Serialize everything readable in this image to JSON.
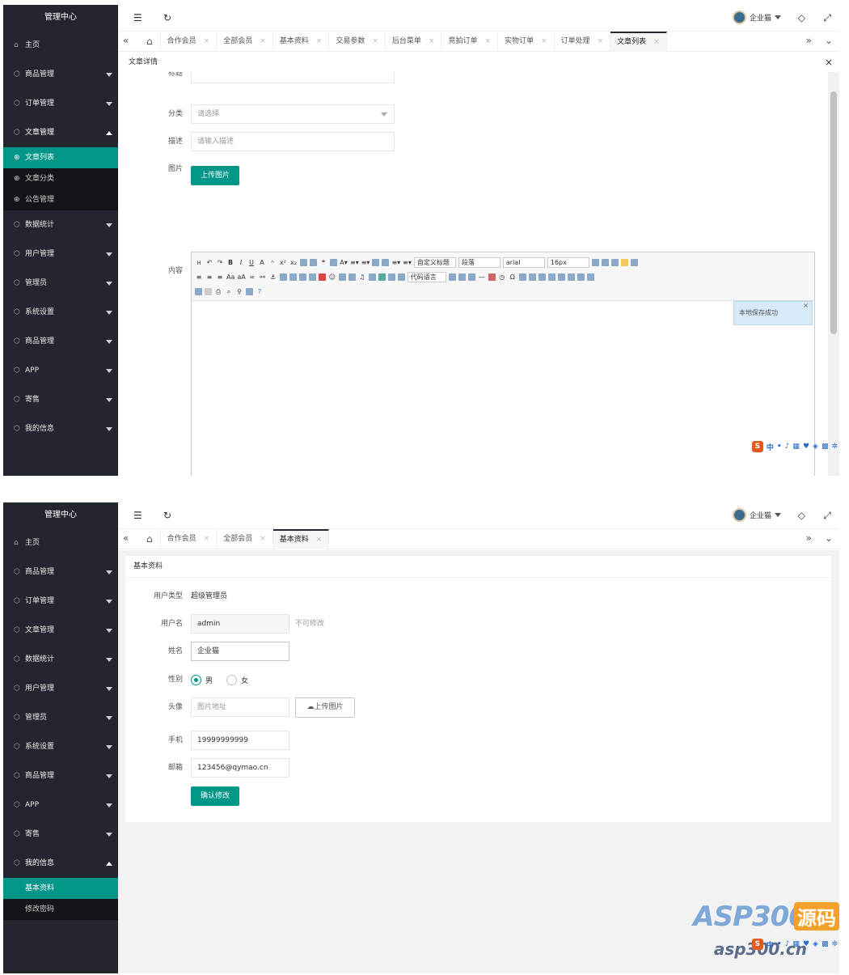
{
  "app_title": "管理中心",
  "home_label": "主页",
  "user_name": "企业猫",
  "sidebar_a": [
    {
      "label": "商品管理"
    },
    {
      "label": "订单管理"
    },
    {
      "label": "文章管理"
    }
  ],
  "sidebar_a_sub": [
    {
      "label": "文章列表"
    },
    {
      "label": "文章分类"
    },
    {
      "label": "公告管理"
    }
  ],
  "sidebar_a_rest": [
    {
      "label": "数据统计"
    },
    {
      "label": "用户管理"
    },
    {
      "label": "管理员"
    },
    {
      "label": "系统设置"
    },
    {
      "label": "商品管理"
    },
    {
      "label": "APP"
    },
    {
      "label": "寄售"
    },
    {
      "label": "我的信息"
    }
  ],
  "sidebar_b": [
    {
      "label": "商品管理"
    },
    {
      "label": "订单管理"
    },
    {
      "label": "文章管理"
    },
    {
      "label": "数据统计"
    },
    {
      "label": "用户管理"
    },
    {
      "label": "管理员"
    },
    {
      "label": "系统设置"
    },
    {
      "label": "商品管理"
    },
    {
      "label": "APP"
    },
    {
      "label": "寄售"
    },
    {
      "label": "我的信息"
    }
  ],
  "sidebar_b_sub": [
    {
      "label": "基本资料"
    },
    {
      "label": "修改密码"
    }
  ],
  "tabs_a": [
    {
      "label": "合作会员"
    },
    {
      "label": "全部会员"
    },
    {
      "label": "基本资料"
    },
    {
      "label": "交易参数"
    },
    {
      "label": "后台菜单"
    },
    {
      "label": "竞拍订单"
    },
    {
      "label": "实物订单"
    },
    {
      "label": "订单处理"
    },
    {
      "label": "文章列表"
    }
  ],
  "tabs_b": [
    {
      "label": "合作会员"
    },
    {
      "label": "全部会员"
    },
    {
      "label": "基本资料"
    }
  ],
  "article": {
    "dialog_title": "文章详情",
    "title_label": "标题",
    "category_label": "分类",
    "category_value": "请选择",
    "desc_label": "描述",
    "desc_placeholder": "请输入描述",
    "image_label": "图片",
    "upload_button": "上传图片",
    "content_label": "内容",
    "toolbar_selects": [
      "自定义标题",
      "段落",
      "arial",
      "16px",
      "代码语言"
    ],
    "toast": "本地保存成功",
    "close_glyph": "×"
  },
  "profile": {
    "card_title": "基本资料",
    "type_label": "用户类型",
    "type_value": "超级管理员",
    "username_label": "用户名",
    "username_value": "admin",
    "username_note": "不可修改",
    "name_label": "姓名",
    "name_value": "企业猫",
    "gender_label": "性别",
    "gender_male": "男",
    "gender_female": "女",
    "gender_selected": "男",
    "avatar_label": "头像",
    "avatar_placeholder": "图片地址",
    "avatar_upload": "上传图片",
    "phone_label": "手机",
    "phone_value": "19999999999",
    "email_label": "邮箱",
    "email_value": "123456@qymao.cn",
    "submit_button": "确认修改"
  },
  "ime": {
    "logo": "S",
    "text": "中"
  },
  "watermark": {
    "line1": "ASP300",
    "line2": "源码",
    "line3": "asp300.cn"
  },
  "colors": {
    "sidebar": "#23262e",
    "accent": "#009688",
    "submenu": "#121419"
  }
}
